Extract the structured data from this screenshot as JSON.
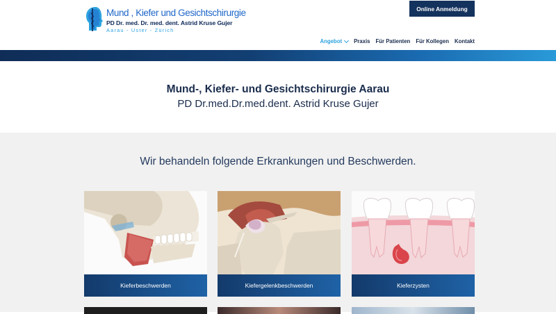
{
  "logo": {
    "title": "Mund , Kiefer  und Gesichtschirurgie",
    "subtitle": "PD Dr. med. Dr. med. dent. Astrid Kruse Gujer",
    "locations": "Aarau - Uster - Zürich",
    "icon": "head-profile-staff-icon"
  },
  "header": {
    "login_label": "Online Anmeldung"
  },
  "nav": {
    "items": [
      {
        "label": "Angebot",
        "active": true,
        "has_dropdown": true
      },
      {
        "label": "Praxis",
        "active": false
      },
      {
        "label": "Für Patienten",
        "active": false
      },
      {
        "label": "Für Kollegen",
        "active": false
      },
      {
        "label": "Kontakt",
        "active": false
      }
    ]
  },
  "hero": {
    "title": "Mund-, Kiefer- und Gesichtschirurgie Aarau",
    "subtitle": "PD Dr.med.Dr.med.dent. Astrid Kruse Gujer"
  },
  "services": {
    "heading": "Wir behandeln folgende Erkrankungen und Beschwerden.",
    "cards": [
      {
        "label": "Kieferbeschwerden",
        "image": "skull-jaw-illustration"
      },
      {
        "label": "Kiefergelenkbeschwerden",
        "image": "jaw-joint-illustration"
      },
      {
        "label": "Kieferzysten",
        "image": "teeth-cyst-illustration"
      }
    ]
  },
  "colors": {
    "navy": "#14325e",
    "accent": "#2ea3e0",
    "text": "#1a2c4c",
    "section_bg": "#f1f1f1"
  }
}
